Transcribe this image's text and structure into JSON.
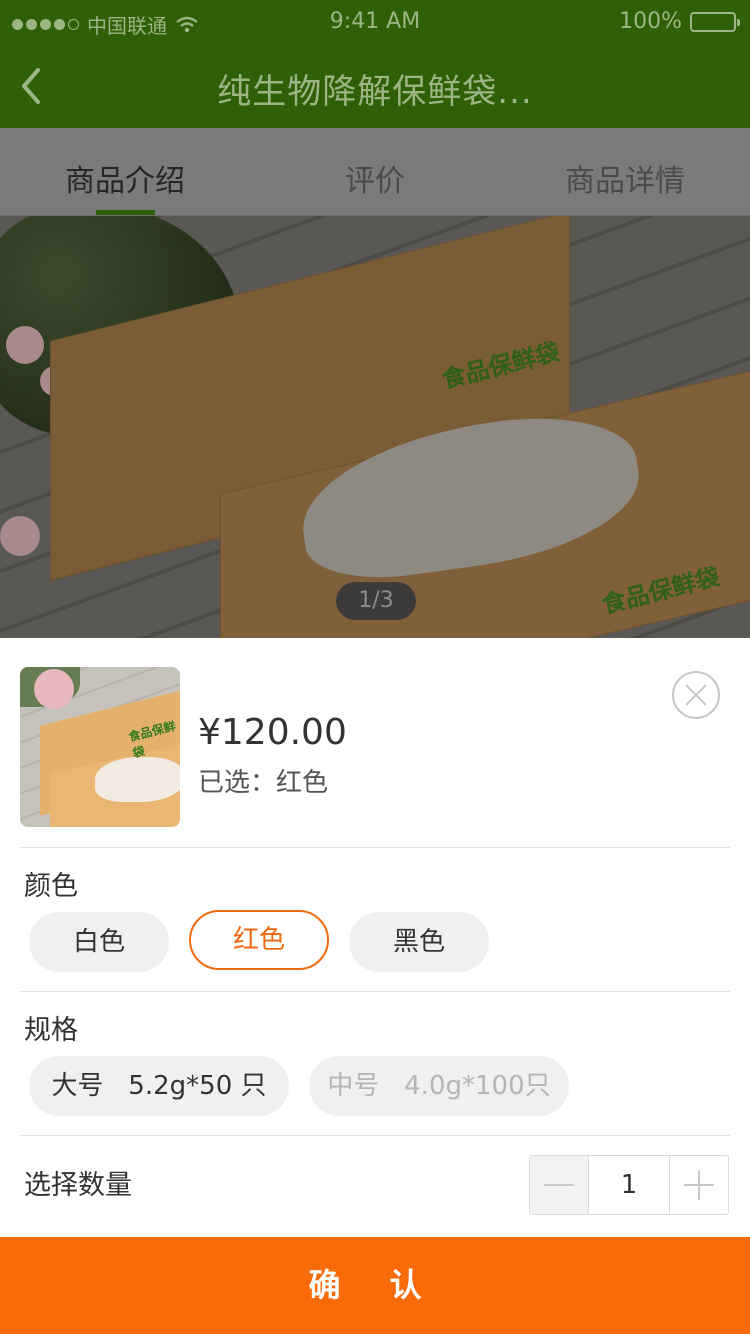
{
  "status_bar": {
    "carrier": "中国联通",
    "time": "9:41 AM",
    "battery": "100%"
  },
  "nav": {
    "title": "纯生物降解保鲜袋..."
  },
  "tabs": [
    {
      "label": "商品介绍"
    },
    {
      "label": "评价"
    },
    {
      "label": "商品详情"
    }
  ],
  "gallery": {
    "pager": "1/3",
    "package_text": "食品保鲜袋"
  },
  "sheet": {
    "price": "¥120.00",
    "selected_text": "已选：红色",
    "color_title": "颜色",
    "colors": [
      "白色",
      "红色",
      "黑色"
    ],
    "spec_title": "规格",
    "specs": [
      "大号   5.2g*50 只",
      "中号   4.0g*100只"
    ],
    "quantity_title": "选择数量",
    "quantity": "1",
    "confirm_label": "确 认"
  },
  "colors": {
    "accent": "#f26a0f",
    "confirm_bg": "#f96a09",
    "nav_green": "#2f5f07"
  }
}
